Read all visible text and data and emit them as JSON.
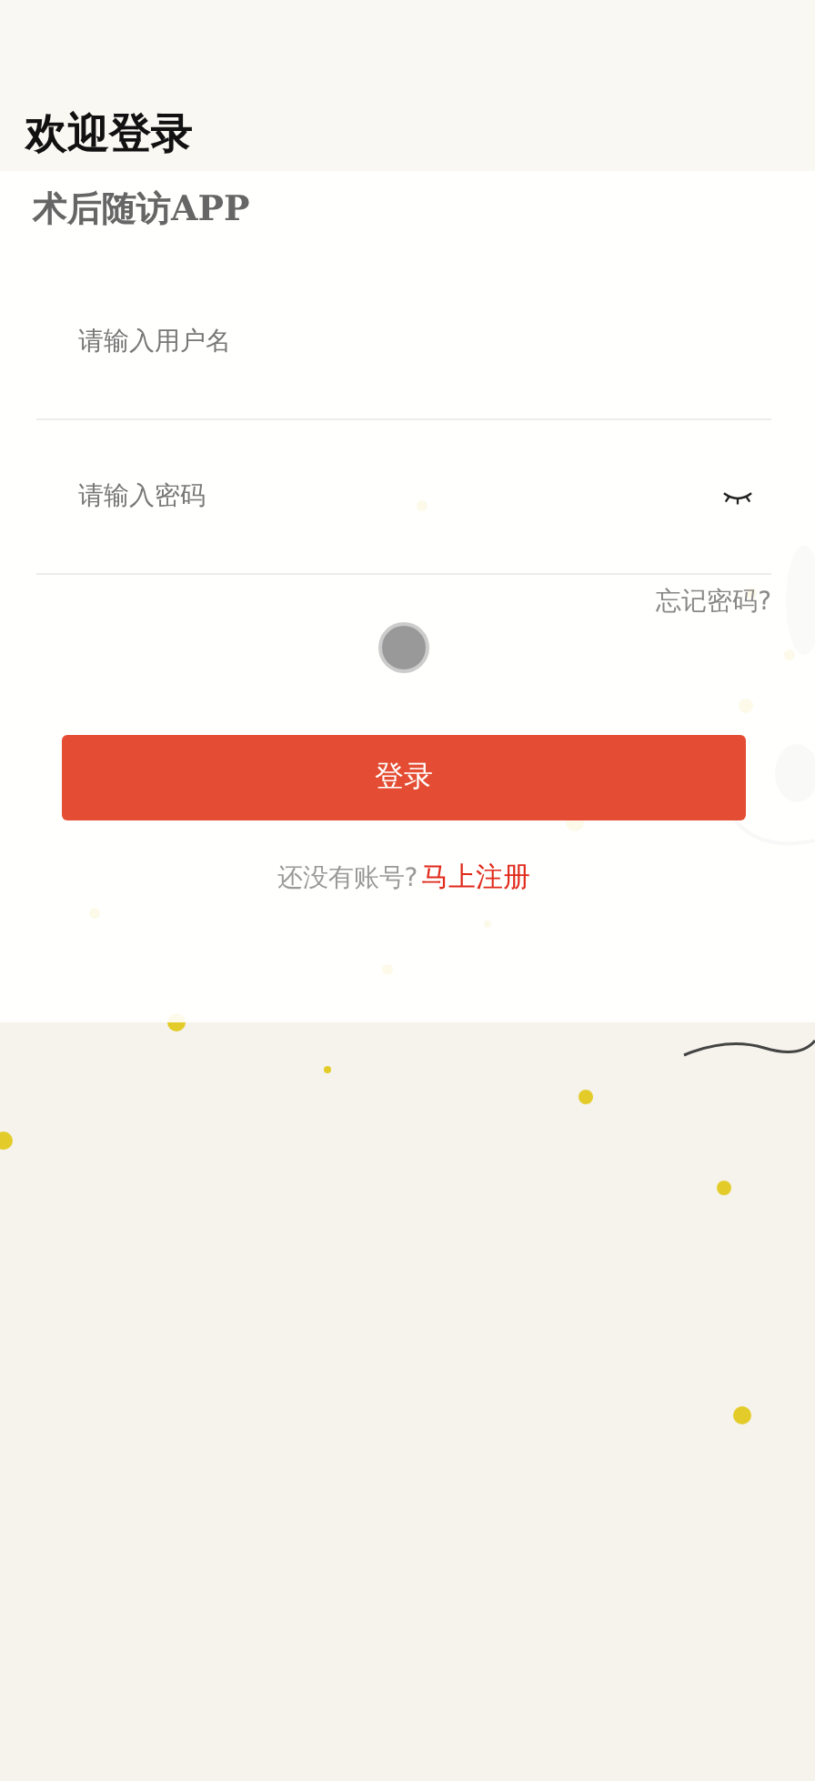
{
  "header": {
    "title": "欢迎登录"
  },
  "card": {
    "subtitle": "术后随访APP",
    "fields": [
      {
        "kind": "text",
        "placeholder": "请输入用户名"
      },
      {
        "kind": "password",
        "placeholder": "请输入密码",
        "show_password": false
      }
    ],
    "forgot_link": "忘记密码?",
    "login_button": "登录",
    "register": {
      "prompt": "还没有账号?",
      "link": "马上注册"
    }
  }
}
